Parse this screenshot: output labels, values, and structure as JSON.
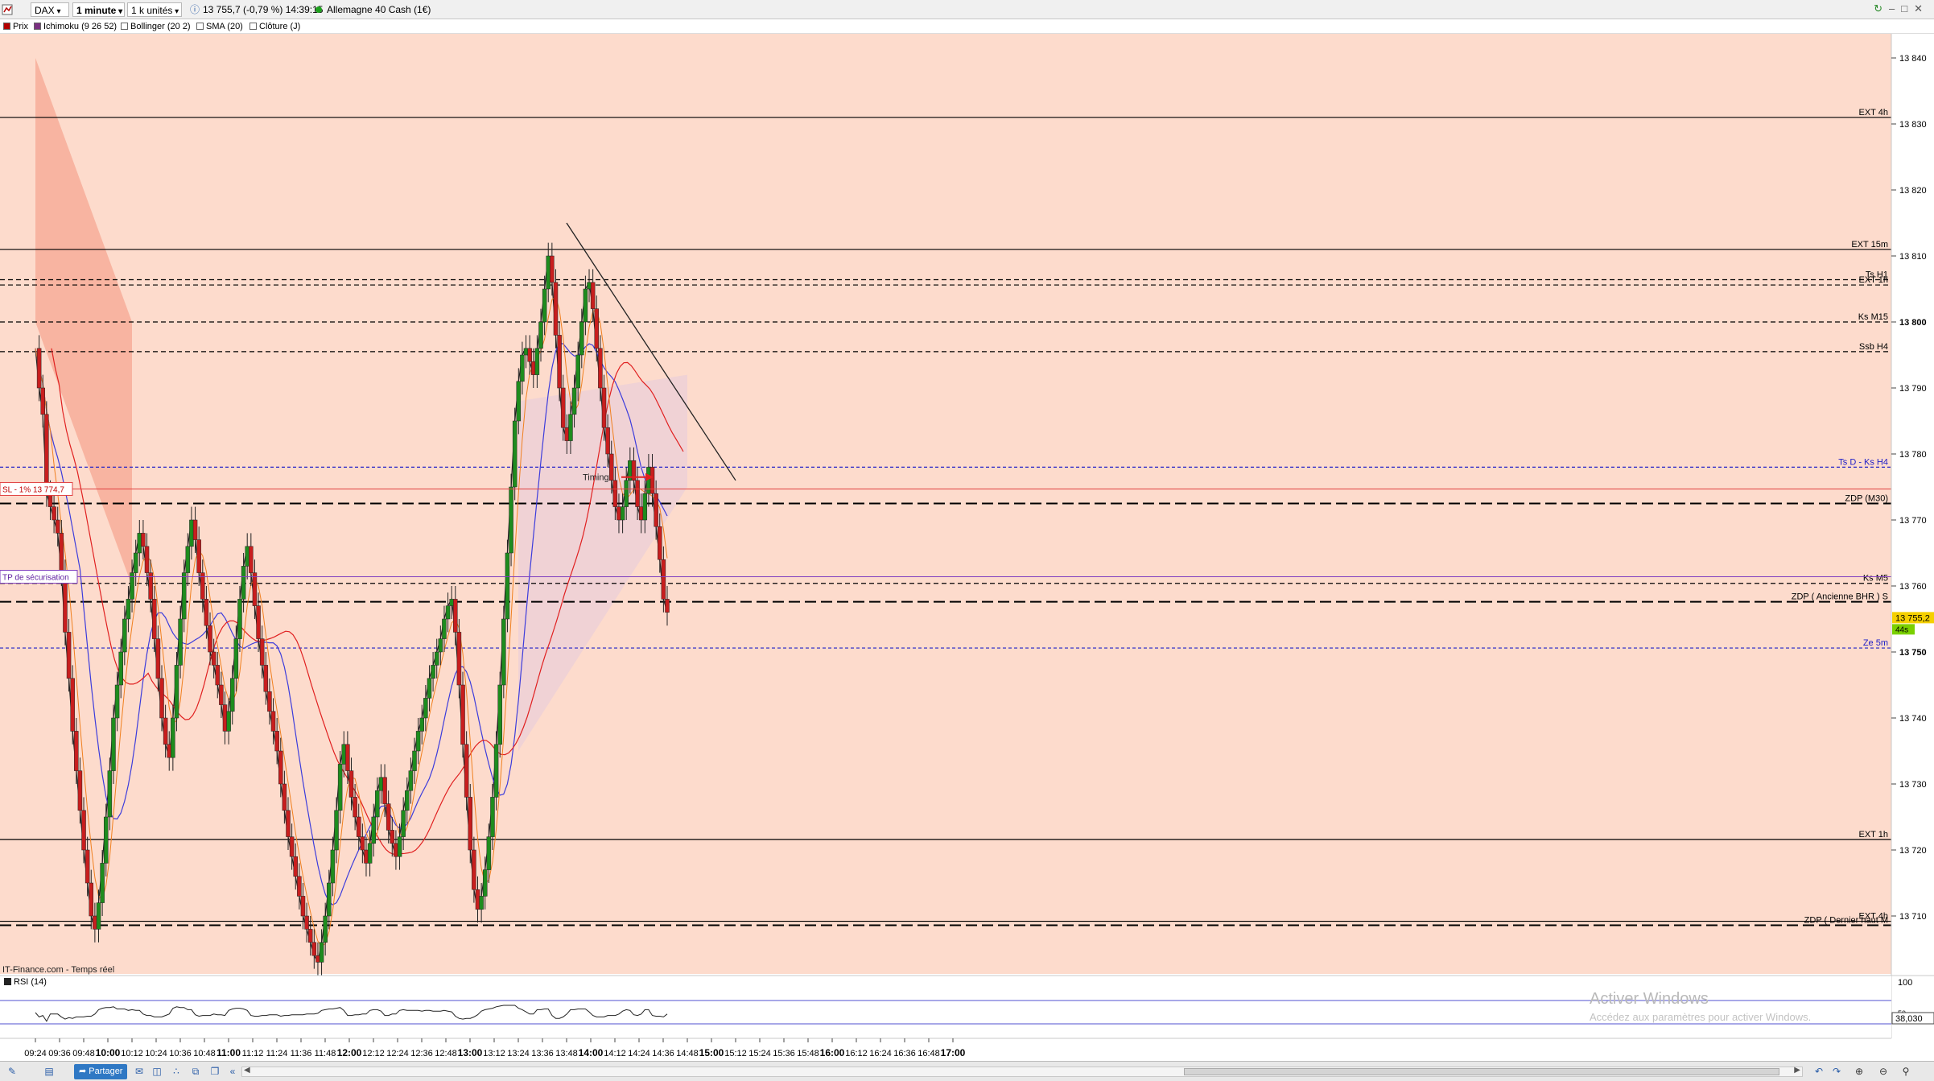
{
  "toolbar": {
    "instrument": "DAX",
    "timeframe": "1 minute",
    "units": "1 k unités",
    "info_icon": "info-icon",
    "quote": "13 755,7 (-0,79 %) 14:39:15",
    "status_color": "#1ea21e",
    "instrument_name": "Allemagne 40 Cash (1€)"
  },
  "indicators": [
    {
      "label": "Prix",
      "color": "#b40000"
    },
    {
      "label": "Ichimoku (9 26 52)",
      "color": "#7a3080"
    },
    {
      "label": "Bollinger (20 2)",
      "color": "#ffffff"
    },
    {
      "label": "SMA (20)",
      "color": "#ffffff"
    },
    {
      "label": "Clôture (J)",
      "color": "#ffffff"
    }
  ],
  "chart_data": {
    "type": "candlestick",
    "y_ticks": [
      "13 840",
      "13 830",
      "13 820",
      "13 810",
      "13 800",
      "13 790",
      "13 780",
      "13 770",
      "13 760",
      "13 750",
      "13 740",
      "13 730",
      "13 720",
      "13 710"
    ],
    "x_ticks": [
      "09:24",
      "09:36",
      "09:48",
      "10:00",
      "10:12",
      "10:24",
      "10:36",
      "10:48",
      "11:00",
      "11:12",
      "11:24",
      "11:36",
      "11:48",
      "12:00",
      "12:12",
      "12:24",
      "12:36",
      "12:48",
      "13:00",
      "13:12",
      "13:24",
      "13:36",
      "13:48",
      "14:00",
      "14:12",
      "14:24",
      "14:36",
      "14:48",
      "15:00",
      "15:12",
      "15:24",
      "15:36",
      "15:48",
      "16:00",
      "16:12",
      "16:24",
      "16:36",
      "16:48",
      "17:00"
    ],
    "bold_x_ticks": [
      "10:00",
      "11:00",
      "12:00",
      "13:00",
      "14:00",
      "15:00",
      "16:00",
      "17:00"
    ],
    "close_path": [
      13796,
      13790,
      13786,
      13774,
      13772,
      13770,
      13768,
      13762,
      13753,
      13746,
      13738,
      13732,
      13726,
      13720,
      13715,
      13710,
      13708,
      13712,
      13718,
      13725,
      13732,
      13740,
      13745,
      13750,
      13755,
      13758,
      13762,
      13765,
      13768,
      13766,
      13762,
      13758,
      13752,
      13746,
      13740,
      13736,
      13734,
      13740,
      13748,
      13755,
      13762,
      13766,
      13770,
      13767,
      13762,
      13758,
      13754,
      13750,
      13748,
      13745,
      13742,
      13738,
      13741,
      13746,
      13752,
      13758,
      13763,
      13766,
      13762,
      13757,
      13752,
      13748,
      13744,
      13741,
      13738,
      13735,
      13730,
      13726,
      13722,
      13719,
      13716,
      13713,
      13710,
      13708,
      13706,
      13704,
      13703,
      13706,
      13710,
      13715,
      13720,
      13726,
      13733,
      13736,
      13732,
      13728,
      13725,
      13722,
      13720,
      13718,
      13721,
      13725,
      13729,
      13731,
      13727,
      13723,
      13721,
      13719,
      13722,
      13726,
      13729,
      13732,
      13735,
      13738,
      13740,
      13743,
      13746,
      13748,
      13750,
      13752,
      13755,
      13757,
      13758,
      13753,
      13745,
      13736,
      13728,
      13720,
      13714,
      13711,
      13713,
      13717,
      13722,
      13728,
      13736,
      13745,
      13755,
      13765,
      13775,
      13785,
      13791,
      13795,
      13796,
      13794,
      13792,
      13796,
      13800,
      13805,
      13810,
      13806,
      13798,
      13790,
      13784,
      13782,
      13786,
      13790,
      13795,
      13800,
      13805,
      13806,
      13802,
      13796,
      13790,
      13784,
      13780,
      13776,
      13772,
      13770,
      13772,
      13776,
      13779,
      13776,
      13772,
      13770,
      13774,
      13778,
      13774,
      13769,
      13764,
      13758,
      13756
    ],
    "ichimoku_cloud_spans": [
      {
        "from": "09:24",
        "to": "10:12",
        "top": [
          13840,
          13800
        ],
        "bottom": [
          13800,
          13760
        ]
      },
      {
        "from": "13:24",
        "to": "14:48",
        "top": [
          13788,
          13792
        ],
        "bottom": [
          13735,
          13775
        ]
      }
    ],
    "last_price": "13 755,2",
    "countdown": "44s",
    "levels": [
      {
        "label": "EXT 4h",
        "price": 13831,
        "style": "solid"
      },
      {
        "label": "EXT 15m",
        "price": 13811,
        "style": "solid"
      },
      {
        "label": "Ts H1",
        "price": 13806.4,
        "style": "dashed"
      },
      {
        "label": "EXT 1h",
        "price": 13805.6,
        "style": "dashed"
      },
      {
        "label": "Ks M15",
        "price": 13800,
        "style": "dashed"
      },
      {
        "label": "Ssb H4",
        "price": 13795.5,
        "style": "dashed"
      },
      {
        "label": "Ts D - Ks H4",
        "price": 13778,
        "style": "dashed-blue"
      },
      {
        "label": "ZDP (M30)",
        "price": 13772.5,
        "style": "dashed-bold"
      },
      {
        "label": "Ks M5",
        "price": 13760.4,
        "style": "dashed"
      },
      {
        "label": "ZDP ( Ancienne BHR ) S",
        "price": 13757.6,
        "style": "dashed-bold"
      },
      {
        "label": "Ze 5m",
        "price": 13750.6,
        "style": "dashed-blue"
      },
      {
        "label": "EXT 1h",
        "price": 13721.6,
        "style": "solid"
      },
      {
        "label": "EXT 4h",
        "price": 13709.2,
        "style": "solid"
      },
      {
        "label": "ZDP ( Dernier haut M",
        "price": 13708.6,
        "style": "dashed-bold"
      }
    ],
    "tags": [
      {
        "label": "SL - 1% 13 774,7"
      },
      {
        "label": "TP de sécurisation"
      },
      {
        "label": "Timing"
      }
    ],
    "trendline": {
      "from": [
        "13:48",
        13815
      ],
      "to": [
        "15:12",
        13776
      ]
    }
  },
  "rsi": {
    "label": "RSI (14)",
    "ticks": [
      "100",
      "50"
    ],
    "value": "38,030"
  },
  "source_text": "IT-Finance.com - Temps réel",
  "bottom": {
    "share_label": "Partager",
    "icons": [
      "draw-tools-icon",
      "chart-type-icon",
      "share-icon",
      "message-icon",
      "layout-icon",
      "indicator-icon",
      "compare-icon",
      "copy-icon",
      "collapse-icon",
      "scroll-left-icon",
      "scroll-right-icon",
      "undo-icon",
      "redo-icon",
      "zoom-in-icon",
      "zoom-out-icon",
      "zoom-reset-icon"
    ]
  },
  "watermark": {
    "line1": "Activer Windows",
    "line2": "Accédez aux paramètres pour activer Windows."
  }
}
